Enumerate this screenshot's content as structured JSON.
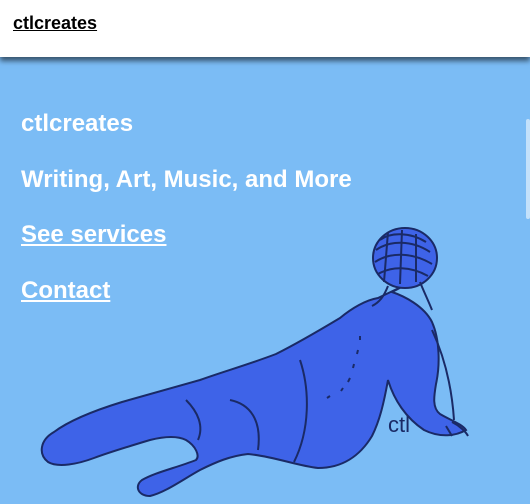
{
  "header": {
    "brand": "ctlcreates"
  },
  "hero": {
    "title": "ctlcreates",
    "subtitle": "Writing, Art, Music, and More",
    "services_link": "See services",
    "contact_link": "Contact"
  },
  "artwork": {
    "signature": "ctl"
  },
  "colors": {
    "background": "#7bbcf5",
    "figure_fill": "#3e63e8",
    "outline": "#1a2a66"
  }
}
